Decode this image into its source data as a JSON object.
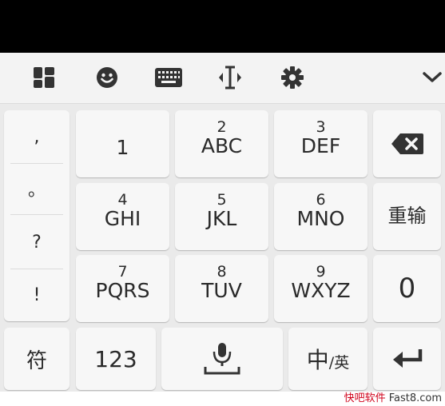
{
  "toolbar": {
    "icons": [
      "layout-icon",
      "emoji-icon",
      "keyboard-icon",
      "cursor-icon",
      "gear-icon",
      "chevron-down-icon"
    ]
  },
  "punctuation": [
    ",",
    "。",
    "?",
    "!"
  ],
  "keys": {
    "k1": {
      "num": "",
      "letters": "1"
    },
    "k2": {
      "num": "2",
      "letters": "ABC"
    },
    "k3": {
      "num": "3",
      "letters": "DEF"
    },
    "k4": {
      "num": "4",
      "letters": "GHI"
    },
    "k5": {
      "num": "5",
      "letters": "JKL"
    },
    "k6": {
      "num": "6",
      "letters": "MNO"
    },
    "k7": {
      "num": "7",
      "letters": "PQRS"
    },
    "k8": {
      "num": "8",
      "letters": "TUV"
    },
    "k9": {
      "num": "9",
      "letters": "WXYZ"
    },
    "k0": "0",
    "reinput": "重输",
    "symbol": "符",
    "numbers": "123",
    "lang_main": "中",
    "lang_alt": "/英"
  },
  "watermark": {
    "part1": "快吧软件",
    "part2": " Fast8.com"
  },
  "colors": {
    "key_bg": "#f7f7f7",
    "keyboard_bg": "#eaeaea",
    "toolbar_bg": "#f3f3f3",
    "icon": "#333333"
  }
}
